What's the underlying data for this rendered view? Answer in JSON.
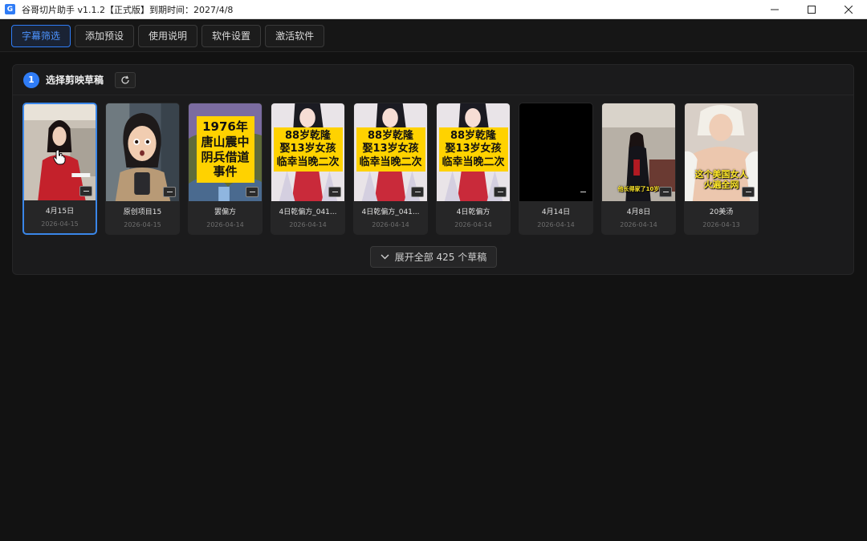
{
  "window": {
    "title": "谷哥切片助手 v1.1.2【正式版】到期时间：2027/4/8",
    "app_icon_glyph": "G",
    "controls": [
      "minimize-icon",
      "maximize-icon",
      "close-icon"
    ]
  },
  "toolbar": {
    "tabs": [
      {
        "label": "字幕筛选",
        "active": true
      },
      {
        "label": "添加预设",
        "active": false
      },
      {
        "label": "使用说明",
        "active": false
      },
      {
        "label": "软件设置",
        "active": false
      },
      {
        "label": "激活软件",
        "active": false
      }
    ]
  },
  "panel": {
    "step": "1",
    "title": "选择剪映草稿",
    "refresh_icon": "refresh-icon",
    "drafts": [
      {
        "name": "4月15日",
        "date": "2026-04-15",
        "selected": true
      },
      {
        "name": "原创项目15",
        "date": "2026-04-15",
        "selected": false
      },
      {
        "name": "罢偏方",
        "date": "2026-04-14",
        "selected": false,
        "overlay": [
          "1976年",
          "唐山震中",
          "阴兵借道",
          "事件"
        ]
      },
      {
        "name": "4日乾偏方_041...",
        "date": "2026-04-14",
        "selected": false,
        "overlay": [
          "88岁乾隆",
          "娶13岁女孩",
          "临幸当晚二次"
        ]
      },
      {
        "name": "4日乾偏方_041...",
        "date": "2026-04-14",
        "selected": false,
        "overlay": [
          "88岁乾隆",
          "娶13岁女孩",
          "临幸当晚二次"
        ]
      },
      {
        "name": "4日乾偏方",
        "date": "2026-04-14",
        "selected": false,
        "overlay": [
          "88岁乾隆",
          "娶13岁女孩",
          "临幸当晚二次"
        ]
      },
      {
        "name": "4月14日",
        "date": "2026-04-14",
        "selected": false
      },
      {
        "name": "4月8日",
        "date": "2026-04-14",
        "selected": false,
        "caption": "他长得家了10岁"
      },
      {
        "name": "20美汤",
        "date": "2026-04-13",
        "selected": false,
        "caption": [
          "这个美国女人",
          "火遍全网"
        ]
      }
    ],
    "expand_label": "展开全部 425 个草稿",
    "expand_icon": "chevron-down-icon"
  },
  "colors": {
    "accent": "#2f7cf6",
    "background": "#121212",
    "panel": "#1b1b1c",
    "overlay_yellow": "#ffd200"
  }
}
